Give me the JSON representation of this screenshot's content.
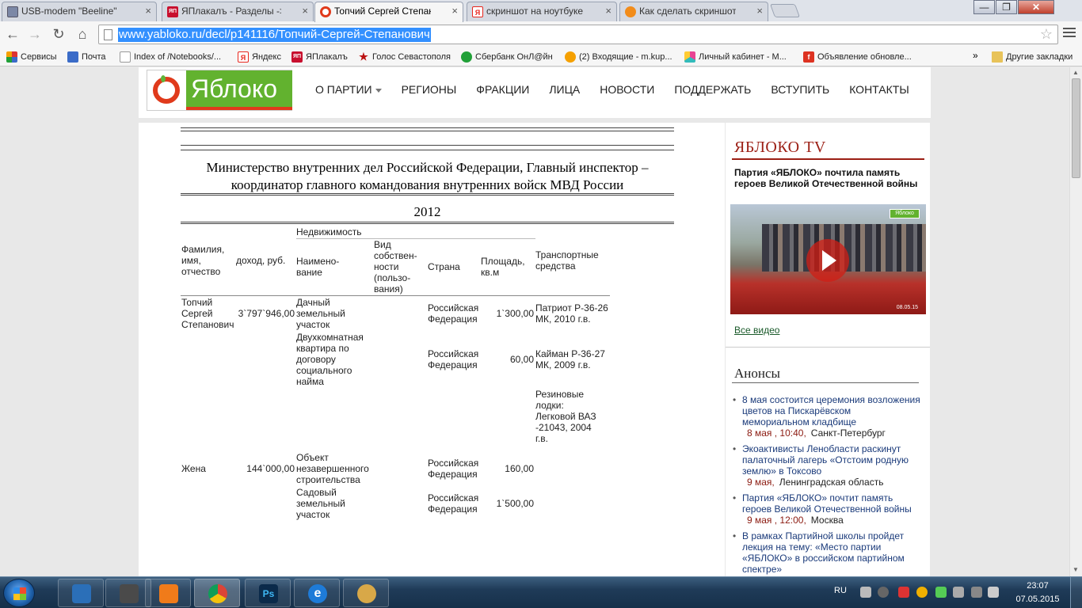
{
  "window": {
    "tabs": [
      {
        "label": "USB-modem \"Beeline\"",
        "icon": "page-icon",
        "color": "#7c88a6"
      },
      {
        "label": "ЯПлакалъ - Разделы -> Отв",
        "icon": "yaplakal-icon",
        "badge": "ЯП",
        "color": "#c8102e"
      },
      {
        "label": "Топчий Сергей Степанович",
        "icon": "yabloko-favicon",
        "color": "#e03a1b"
      },
      {
        "label": "скриншот на ноутбуке — Я",
        "icon": "yandex-icon",
        "badge": "Я",
        "color": "#e8271e"
      },
      {
        "label": "Как сделать скриншот на н",
        "icon": "site-icon",
        "color": "#f28c1a"
      }
    ],
    "active_tab": 2,
    "minimize_glyph": "—",
    "maximize_glyph": "❐",
    "close_glyph": "✕",
    "tab_close_glyph": "×"
  },
  "toolbar": {
    "url": "www.yabloko.ru/decl/p141116/Топчий-Сергей-Степанович",
    "back_glyph": "←",
    "forward_glyph": "→",
    "reload_glyph": "↻",
    "home_glyph": "⌂",
    "star_glyph": "☆"
  },
  "bookmarks": {
    "items": [
      {
        "label": "Сервисы",
        "icon": "apps-icon",
        "color": "#d33"
      },
      {
        "label": "Почта",
        "icon": "mail-icon",
        "color": "#3b6cc8"
      },
      {
        "label": "Index of /Notebooks/...",
        "icon": "page-icon",
        "color": "#999"
      },
      {
        "label": "Яндекс",
        "icon": "yandex-icon",
        "badge": "Я",
        "color": "#e8271e"
      },
      {
        "label": "ЯПлакалъ",
        "icon": "yaplakal-icon",
        "badge": "ЯП",
        "color": "#c8102e"
      },
      {
        "label": "Голос Севастополя",
        "icon": "star-icon",
        "badge": "★",
        "color": "#b11"
      },
      {
        "label": "Сбербанк ОнЛ@йн",
        "icon": "sberbank-icon",
        "color": "#21a038"
      },
      {
        "label": "(2) Входящие - m.kup...",
        "icon": "mail-ru-icon",
        "color": "#f5a000"
      },
      {
        "label": "Личный кабинет - М...",
        "icon": "profile-icon",
        "color": "#e84393"
      },
      {
        "label": "Объявление обновле...",
        "icon": "notice-icon",
        "badge": "f",
        "color": "#d32"
      }
    ],
    "more_glyph": "»",
    "other_label": "Другие закладки"
  },
  "site": {
    "logo_text": "Яблоко",
    "nav": [
      {
        "label": "О ПАРТИИ",
        "dropdown": true
      },
      {
        "label": "РЕГИОНЫ"
      },
      {
        "label": "ФРАКЦИИ"
      },
      {
        "label": "ЛИЦА"
      },
      {
        "label": "НОВОСТИ"
      },
      {
        "label": "ПОДДЕРЖАТЬ"
      },
      {
        "label": "ВСТУПИТЬ"
      },
      {
        "label": "КОНТАКТЫ"
      }
    ]
  },
  "declaration": {
    "position_title": "Министерство внутренних дел Российской Федерации, Главный инспектор – координатор главного командования внутренних войск МВД России",
    "year": "2012",
    "headers": {
      "realty_group": "Недвижимость",
      "name": "Фамилия, имя, отчество",
      "income": "доход, руб.",
      "object": "Наимено- вание",
      "ownership": "Вид собствен- ности (пользо- вания)",
      "country": "Страна",
      "area": "Площадь, кв.м",
      "transport": "Транспортные средства"
    },
    "person": {
      "name": "Топчий Сергей Степанович",
      "income": "3`797`946,00",
      "realty": [
        {
          "object": "Дачный земельный участок",
          "country": "Российская Федерация",
          "area": "1`300,00"
        },
        {
          "object": "Двухкомнатная квартира по договору социального найма",
          "country": "Российская Федерация",
          "area": "60,00"
        }
      ],
      "transport": [
        "Патриот Р-36-26 МК, 2010 г.в.",
        "Кайман Р-36-27 МК, 2009 г.в.",
        "Резиновые лодки: Легковой ВАЗ -21043, 2004 г.в."
      ]
    },
    "spouse": {
      "name": "Жена",
      "income": "144`000,00",
      "realty": [
        {
          "object": "Объект незавершенного строительства",
          "country": "Российская Федерация",
          "area": "160,00"
        },
        {
          "object": "Садовый земельный участок",
          "country": "Российская Федерация",
          "area": "1`500,00"
        }
      ]
    }
  },
  "sidebar": {
    "tv_title": "ЯБЛОКО TV",
    "tv_caption": "Партия «ЯБЛОКО» почтила память героев Великой Отечественной войны",
    "video_badge": "Яблоко",
    "video_date": "08.05.15",
    "all_video": "Все видео",
    "anons_title": "Анонсы",
    "anons": [
      {
        "text": "8 мая состоится церемония возложения цветов на Пискарёвском мемориальном кладбище",
        "date": "8 мая , 10:40,",
        "place": "Санкт-Петербург"
      },
      {
        "text": "Экоактивисты Ленобласти раскинут палаточный лагерь «Отстоим родную землю» в Токсово",
        "date": "9 мая,",
        "place": "Ленинградская область"
      },
      {
        "text": "Партия «ЯБЛОКО» почтит память героев Великой Отечественной войны",
        "date": "9 мая , 12:00,",
        "place": "Москва"
      },
      {
        "text": "В рамках Партийной школы пройдет лекция на тему: «Место партии «ЯБЛОКО» в российском партийном спектре»",
        "date": "",
        "place": ""
      }
    ]
  },
  "taskbar": {
    "apps": [
      {
        "icon": "control-panel-icon",
        "color": "#2b6fb8",
        "active": false
      },
      {
        "icon": "media-player-icon",
        "color": "#4a4a4a",
        "active": false
      },
      {
        "icon": "video-player-icon",
        "color": "#f07b1a",
        "active": false
      },
      {
        "icon": "chrome-icon",
        "color": "#2aa14b",
        "active": true
      },
      {
        "icon": "photoshop-icon",
        "badge": "Ps",
        "color": "#0b2a4a",
        "active": false
      },
      {
        "icon": "internet-explorer-icon",
        "badge": "e",
        "color": "#1e7bd8",
        "active": false
      },
      {
        "icon": "paint-icon",
        "color": "#d8a848",
        "active": false
      }
    ],
    "lang": "RU",
    "time": "23:07",
    "date": "07.05.2015"
  }
}
